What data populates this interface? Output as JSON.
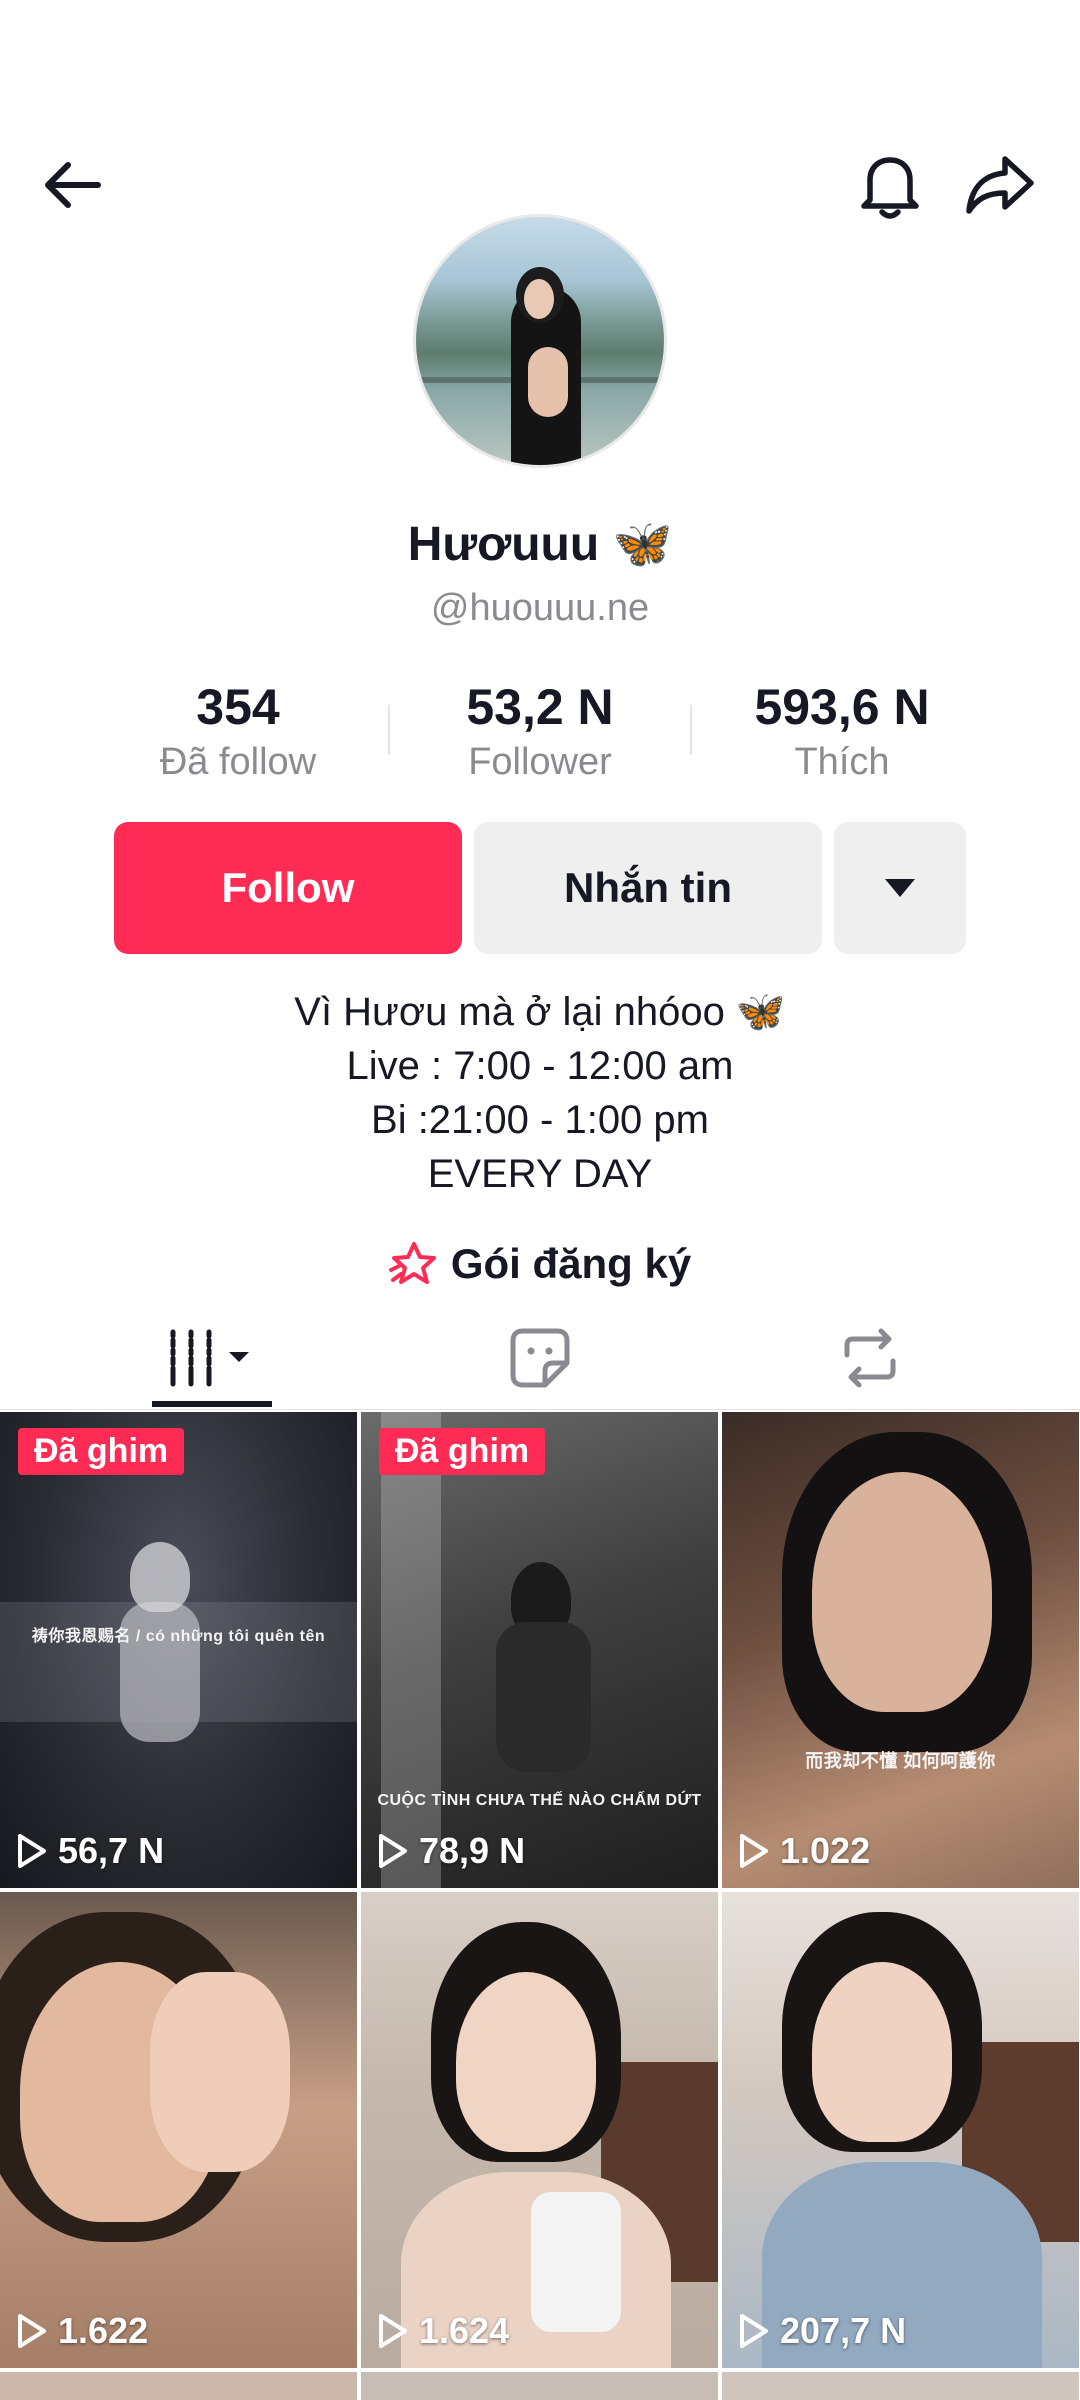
{
  "header": {
    "back_icon": "arrow-left-icon",
    "bell_icon": "bell-icon",
    "share_icon": "share-arrow-icon"
  },
  "profile": {
    "display_name": "Hươuuu 🦋",
    "handle": "@huouuu.ne"
  },
  "stats": [
    {
      "value": "354",
      "label": "Đã follow"
    },
    {
      "value": "53,2 N",
      "label": "Follower"
    },
    {
      "value": "593,6 N",
      "label": "Thích"
    }
  ],
  "actions": {
    "follow_label": "Follow",
    "message_label": "Nhắn tin"
  },
  "bio": {
    "line1": "Vì Hươu mà ở lại nhóoo 🦋",
    "line2": "Live : 7:00 - 12:00 am",
    "line3": "Bi :21:00 - 1:00 pm",
    "line4": "EVERY DAY"
  },
  "subscription": {
    "label": "Gói đăng ký",
    "icon": "star-badge-icon"
  },
  "tabs": [
    "videos-grid-icon",
    "favorites-sticker-icon",
    "repost-icon"
  ],
  "videos": [
    {
      "pinned": "Đã ghim",
      "views": "56,7 N",
      "caption": "祷你我恩赐名 / có những tôi quên tên"
    },
    {
      "pinned": "Đã ghim",
      "views": "78,9 N",
      "caption": "CUỘC TÌNH CHƯA THẾ NÀO CHẤM DỨT"
    },
    {
      "views": "1.022",
      "caption": "而我却不懂 如何呵護你"
    },
    {
      "views": "1.622"
    },
    {
      "views": "1.624"
    },
    {
      "views": "207,7 N"
    }
  ],
  "colors": {
    "accent": "#fe2c55",
    "text_primary": "#161823",
    "text_secondary": "#8a8b91",
    "button_secondary": "#efeff0"
  }
}
